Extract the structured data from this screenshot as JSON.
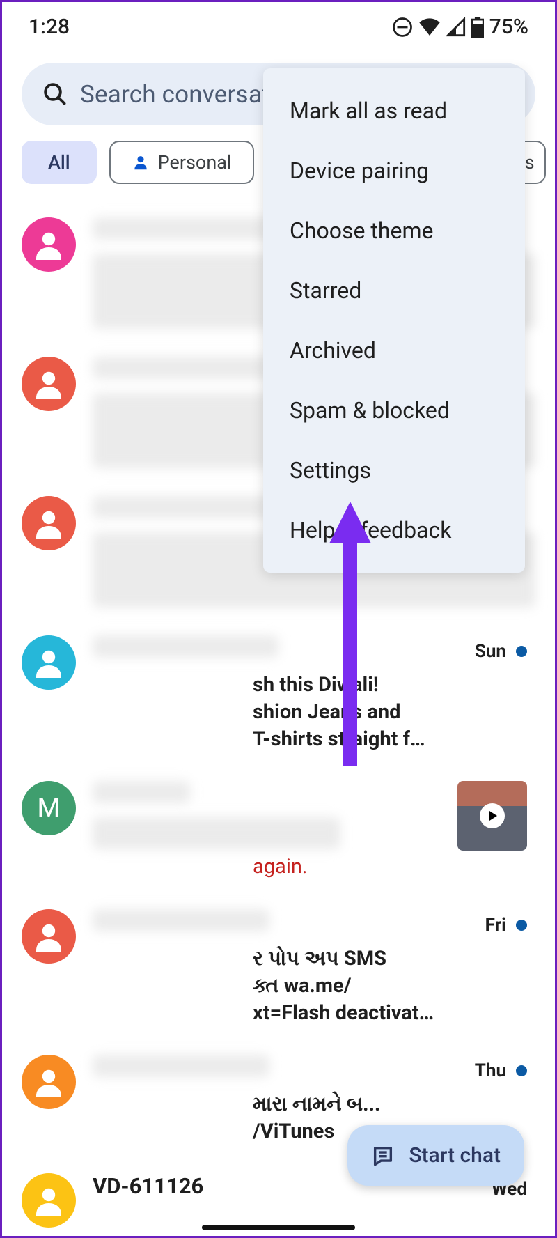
{
  "status": {
    "time": "1:28",
    "battery": "75%"
  },
  "search": {
    "placeholder": "Search conversati"
  },
  "chips": {
    "all": "All",
    "personal": "Personal",
    "otps": "TPs"
  },
  "menu": {
    "mark_all": "Mark all as read",
    "device_pairing": "Device pairing",
    "choose_theme": "Choose theme",
    "starred": "Starred",
    "archived": "Archived",
    "spam_blocked": "Spam & blocked",
    "settings": "Settings",
    "help": "Help & feedback"
  },
  "rows": {
    "r4": {
      "day": "Sun",
      "preview": "sh this Diwali!\nshion Jeans and\nT-shirts straight f…"
    },
    "r5": {
      "letter": "M",
      "preview_tail": "again."
    },
    "r6": {
      "day": "Fri",
      "preview": "ર પોપ અપ SMS\nક્ત wa.me/\nxt=Flash deactivat…"
    },
    "r7": {
      "day": "Thu",
      "preview": "મારા નામને બ...\n/ViTunes"
    },
    "r8": {
      "sender": "VD-611126",
      "day": "Wed"
    }
  },
  "fab": {
    "label": "Start chat"
  }
}
